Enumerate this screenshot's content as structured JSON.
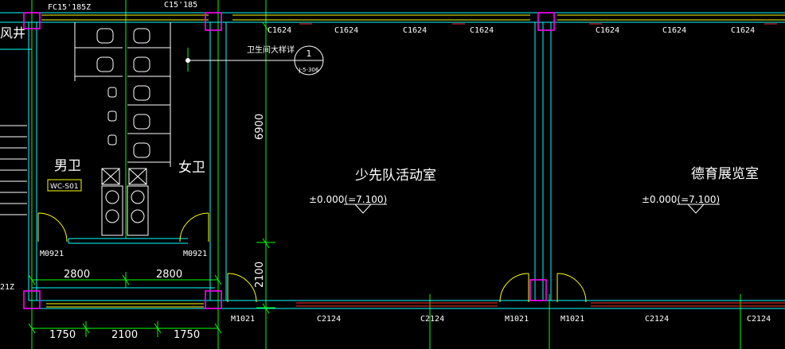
{
  "header_labels": {
    "fc_window": "FC15'185Z",
    "c_window": "C15'185",
    "vent_shaft": "风井"
  },
  "top_windows": [
    "C1624",
    "C1624",
    "C1624",
    "C1624",
    "C1624",
    "C1624",
    "C1624"
  ],
  "callout": {
    "note": "卫生间大样详",
    "number": "1",
    "sheet": "J-5-306"
  },
  "rooms": {
    "mens_toilet": "男卫",
    "womens_toilet": "女卫",
    "pioneers_room": "少先队活动室",
    "moral_exhibit": "德育展览室"
  },
  "tag_label": "WC-S01",
  "elevations": [
    "±0.000(=7.100)",
    "±0.000(=7.100)"
  ],
  "doors": {
    "md_left": "M0921",
    "md_right": "M0921",
    "m1021_a": "M1021",
    "m1021_b": "M1021",
    "m1021_c": "M1021"
  },
  "bottom_windows": [
    "C2124",
    "C2124",
    "C2124",
    "C2124"
  ],
  "dimensions": {
    "vertical_6900": "6900",
    "vertical_2100": "2100",
    "h_2800_a": "2800",
    "h_2800_b": "2800",
    "b_1750_a": "1750",
    "b_2100": "2100",
    "b_1750_b": "1750"
  },
  "edge_label": "21Z",
  "colors": {
    "background": "#000000",
    "wall": "#00ffff",
    "column": "#ff00ff",
    "window": "#ffff00",
    "window_sill": "#ff3030",
    "axis": "#00ff00",
    "fixture": "#ffffff",
    "door_swing": "#ffff00",
    "tag": "#ffff00"
  }
}
